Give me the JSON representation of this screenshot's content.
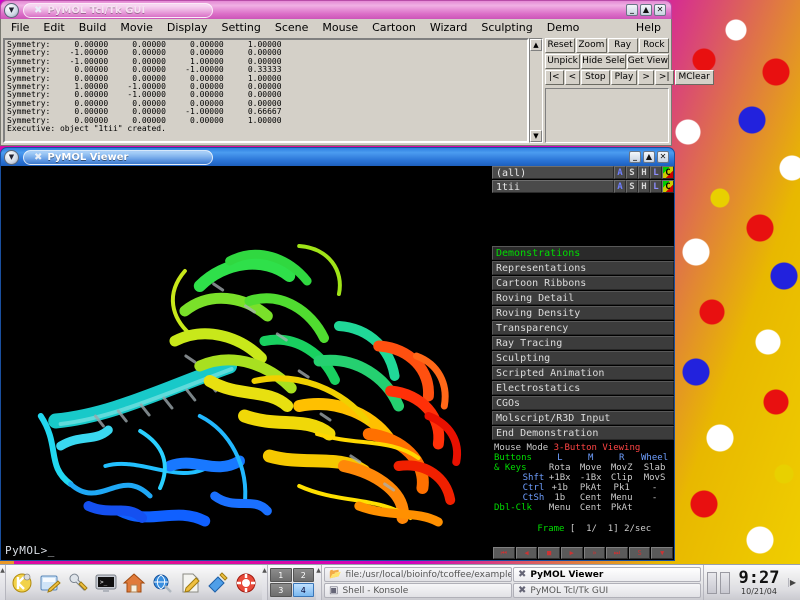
{
  "desktop": {
    "wallpaper_desc": "space-filling-dna-model"
  },
  "tk_window": {
    "title": "PyMOL Tcl/Tk GUI",
    "app_icon": "pymol-x-icon",
    "menu_button": "window-menu-icon",
    "controls": {
      "minimize": "_",
      "maximize": "▲",
      "close": "✕"
    },
    "menubar": [
      {
        "label": "File",
        "accel": "F"
      },
      {
        "label": "Edit",
        "accel": "E"
      },
      {
        "label": "Build",
        "accel": "B"
      },
      {
        "label": "Movie",
        "accel": "M"
      },
      {
        "label": "Display",
        "accel": "D"
      },
      {
        "label": "Setting",
        "accel": "S"
      },
      {
        "label": "Scene",
        "accel": "c"
      },
      {
        "label": "Mouse",
        "accel": "o"
      },
      {
        "label": "Cartoon",
        "accel": "r"
      },
      {
        "label": "Wizard",
        "accel": "W"
      },
      {
        "label": "Sculpting",
        "accel": "u"
      },
      {
        "label": "Demo",
        "accel": ""
      }
    ],
    "help_label": "Help",
    "console": "Symmetry:     0.00000     0.00000     0.00000     1.00000\nSymmetry:    -1.00000     0.00000     0.00000     0.00000\nSymmetry:    -1.00000     0.00000     1.00000     0.00000\nSymmetry:     0.00000     0.00000    -1.00000     0.33333\nSymmetry:     0.00000     0.00000     0.00000     1.00000\nSymmetry:     1.00000    -1.00000     0.00000     0.00000\nSymmetry:     0.00000    -1.00000     0.00000     0.00000\nSymmetry:     0.00000     0.00000     0.00000     0.00000\nSymmetry:     0.00000     0.00000    -1.00000     0.66667\nSymmetry:     0.00000     0.00000     0.00000     1.00000\nExecutive: object \"1tii\" created.",
    "scrollbar": {
      "up": "▲",
      "down": "▼"
    },
    "buttons_row1": [
      "Reset",
      "Zoom",
      "Ray",
      "Rock"
    ],
    "buttons_row2": [
      "Unpick",
      "Hide Sele",
      "Get View"
    ],
    "buttons_row3": [
      "|<",
      "<",
      "Stop",
      "Play",
      ">",
      ">|",
      "MClear"
    ]
  },
  "viewer_window": {
    "title": "PyMOL Viewer",
    "app_icon": "pymol-x-icon",
    "menu_button": "window-menu-icon",
    "controls": {
      "minimize": "_",
      "maximize": "▲",
      "close": "✕"
    },
    "prompt": "PyMOL>_",
    "objects": [
      {
        "name": "(all)",
        "buttons": [
          "A",
          "S",
          "H",
          "L",
          "C"
        ]
      },
      {
        "name": "1tii",
        "buttons": [
          "A",
          "S",
          "H",
          "L",
          "C"
        ]
      }
    ],
    "menu_list": [
      {
        "label": "Demonstrations",
        "header": true
      },
      {
        "label": "Representations",
        "header": false
      },
      {
        "label": "Cartoon Ribbons",
        "header": false
      },
      {
        "label": "Roving Detail",
        "header": false
      },
      {
        "label": "Roving Density",
        "header": false
      },
      {
        "label": "Transparency",
        "header": false
      },
      {
        "label": "Ray Tracing",
        "header": false
      },
      {
        "label": "Sculpting",
        "header": false
      },
      {
        "label": "Scripted Animation",
        "header": false
      },
      {
        "label": "Electrostatics",
        "header": false
      },
      {
        "label": "CGOs",
        "header": false
      },
      {
        "label": "Molscript/R3D Input",
        "header": false
      },
      {
        "label": "End Demonstration",
        "header": false
      }
    ],
    "mouse_mode": {
      "title_label": "Mouse Mode",
      "title_value": "3-Button Viewing",
      "col_headers": [
        "L",
        "M",
        "R",
        "Wheel"
      ],
      "row_labels": [
        "Buttons",
        "& Keys",
        "Shft",
        "Ctrl",
        "CtSh",
        "Dbl-Clk"
      ],
      "rows": [
        {
          "label": "",
          "cells": [
            "Rota",
            "Move",
            "MovZ",
            "Slab"
          ]
        },
        {
          "label": "Shft",
          "cells": [
            "+1Bx",
            "-1Bx",
            "Clip",
            "MovS"
          ]
        },
        {
          "label": "Ctrl",
          "cells": [
            "+1b",
            "PkAt",
            "Pk1",
            "-"
          ]
        },
        {
          "label": "CtSh",
          "cells": [
            "1b",
            "Cent",
            "Menu",
            "-"
          ]
        },
        {
          "label": "Dbl-Clk",
          "cells": [
            "Menu",
            "Cent",
            "PkAt",
            ""
          ]
        }
      ]
    },
    "frame": {
      "label": "Frame",
      "value": "[  1/  1]",
      "rate": "2/sec",
      "buttons": [
        "⏮",
        "◀",
        "■",
        "▶",
        "»",
        "⏭",
        "S",
        "▼"
      ]
    }
  },
  "taskbar": {
    "launchers": [
      {
        "name": "k-menu-icon",
        "glyph": "K"
      },
      {
        "name": "show-desktop-icon",
        "glyph": "✎"
      },
      {
        "name": "config-tools-icon",
        "glyph": "⚒"
      },
      {
        "name": "terminal-icon",
        "glyph": "▣"
      },
      {
        "name": "home-folder-icon",
        "glyph": "⌂"
      },
      {
        "name": "web-browser-icon",
        "glyph": "⎈"
      },
      {
        "name": "text-editor-icon",
        "glyph": "✍"
      },
      {
        "name": "paint-icon",
        "glyph": "✒"
      },
      {
        "name": "help-icon",
        "glyph": "⊕"
      }
    ],
    "pager": [
      {
        "label": "1",
        "active": false
      },
      {
        "label": "2",
        "active": false
      },
      {
        "label": "3",
        "active": false
      },
      {
        "label": "4",
        "active": true
      }
    ],
    "tasks": [
      {
        "label": "file:/usr/local/bioinfo/tcoffee/example",
        "icon": "konqueror-icon",
        "active": false
      },
      {
        "label": "PyMOL Viewer",
        "icon": "pymol-x-icon",
        "active": true
      },
      {
        "label": "Shell - Konsole",
        "icon": "konsole-icon",
        "active": false
      },
      {
        "label": "PyMOL Tcl/Tk GUI",
        "icon": "pymol-x-icon",
        "active": false
      }
    ],
    "clock": {
      "time": "9:27",
      "date": "10/21/04"
    },
    "tray_arrow": "▶"
  },
  "colors": {
    "active_title": "#2f7fe0",
    "inactive_title": "#e48ad4",
    "panel_bg": "#d4d0c8",
    "viewer_bg": "#000000",
    "menu_header_text": "#00dd00",
    "mouse_mode_value": "#ff4444",
    "desktop_magenta": "#d400c8"
  }
}
